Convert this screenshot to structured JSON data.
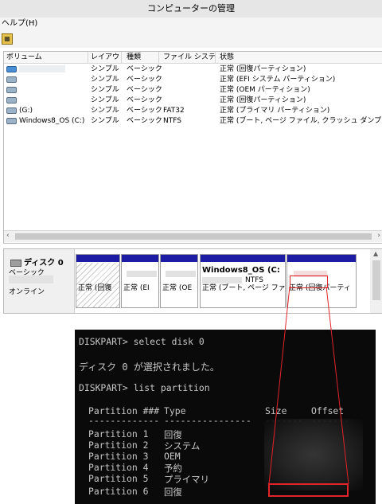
{
  "window": {
    "title": "コンピューターの管理"
  },
  "menu": {
    "items": [
      "ヘルプ(H)"
    ]
  },
  "volume_list": {
    "columns": [
      "ボリューム",
      "レイアウト",
      "種類",
      "ファイル システム",
      "状態"
    ],
    "rows": [
      {
        "volume": "",
        "layout": "シンプル",
        "type": "ベーシック",
        "fs": "",
        "status": "正常 (回復パーティション)"
      },
      {
        "volume": "",
        "layout": "シンプル",
        "type": "ベーシック",
        "fs": "",
        "status": "正常 (EFI システム パーティション)"
      },
      {
        "volume": "",
        "layout": "シンプル",
        "type": "ベーシック",
        "fs": "",
        "status": "正常 (OEM パーティション)"
      },
      {
        "volume": "",
        "layout": "シンプル",
        "type": "ベーシック",
        "fs": "",
        "status": "正常 (回復パーティション)"
      },
      {
        "volume": "(G:)",
        "layout": "シンプル",
        "type": "ベーシック",
        "fs": "FAT32",
        "status": "正常 (プライマリ パーティション)"
      },
      {
        "volume": "Windows8_OS (C:)",
        "layout": "シンプル",
        "type": "ベーシック",
        "fs": "NTFS",
        "status": "正常 (ブート, ページ ファイル, クラッシュ ダンプ, プライマ"
      }
    ]
  },
  "disk": {
    "title": "ディスク 0",
    "type": "ベーシック",
    "status": "オンライン",
    "partitions": [
      {
        "name": "",
        "fs": "",
        "label": "正常 (回復"
      },
      {
        "name": "",
        "fs": "",
        "label": "正常 (EI"
      },
      {
        "name": "",
        "fs": "",
        "label": "正常 (OE"
      },
      {
        "name": "Windows8_OS  (C:",
        "fs": "NTFS",
        "label": "正常 (ブート, ページ ファ"
      },
      {
        "name": "",
        "fs": "",
        "label": "正常 (回復パーティ"
      }
    ]
  },
  "console": {
    "lines": [
      "DISKPART> select disk 0",
      "ディスク 0 が選択されました。",
      "DISKPART> list partition"
    ],
    "table_header": {
      "partition": "Partition ###",
      "type": "Type",
      "size": "Size",
      "offset": "Offset"
    },
    "table_rule": {
      "partition": "-------------",
      "type": "----------------",
      "size": "-------",
      "offset": "-------"
    },
    "partitions": [
      {
        "partition": "Partition 1",
        "type": "回復"
      },
      {
        "partition": "Partition 2",
        "type": "システム"
      },
      {
        "partition": "Partition 3",
        "type": "OEM"
      },
      {
        "partition": "Partition 4",
        "type": "予約"
      },
      {
        "partition": "Partition 5",
        "type": "プライマリ"
      },
      {
        "partition": "Partition 6",
        "type": "回復"
      }
    ]
  },
  "colors": {
    "highlight": "#e0242a",
    "partition_bar": "#1c1ca4",
    "console_bg": "#0a0a0a"
  }
}
